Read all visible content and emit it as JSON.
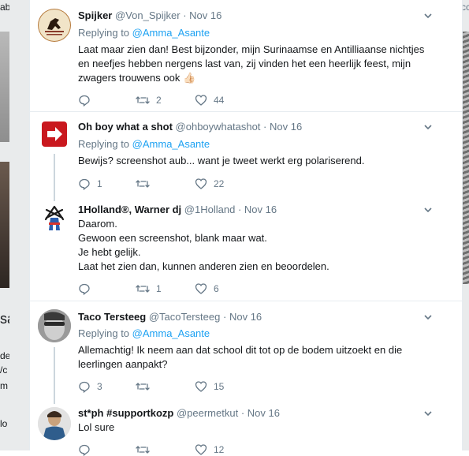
{
  "background": {
    "left_fragments": [
      "ab",
      "sa",
      "de",
      "/c",
      "m",
      "lo"
    ],
    "right_fragments": [
      "cc"
    ]
  },
  "tweets": [
    {
      "name": "Spijker",
      "handle": "@Von_Spijker",
      "time": "Nov 16",
      "replying_label": "Replying to",
      "replying_to": "@Amma_Asante",
      "lines": [
        "Laat maar zien dan! Best bijzonder, mijn Surinaamse en Antilliaanse nichtjes",
        "en neefjes hebben nergens last van, zij vinden het een heerlijk feest, mijn",
        "zwagers trouwens ook 👍🏻"
      ],
      "retweets": "2",
      "likes": "44",
      "replies": ""
    },
    {
      "name": "Oh boy what a shot",
      "handle": "@ohboywhatashot",
      "time": "Nov 16",
      "replying_label": "Replying to",
      "replying_to": "@Amma_Asante",
      "lines": [
        "Bewijs? screenshot aub... want je tweet werkt erg polariserend."
      ],
      "replies": "1",
      "retweets": "",
      "likes": "22"
    },
    {
      "name": "1Holland®, Warner dj",
      "handle": "@1Holland",
      "time": "Nov 16",
      "lines": [
        "Daarom.",
        "Gewoon een screenshot, blank maar wat.",
        "Je hebt gelijk.",
        "Laat het zien dan, kunnen anderen zien en beoordelen."
      ],
      "replies": "",
      "retweets": "1",
      "likes": "6"
    },
    {
      "name": "Taco Tersteeg",
      "handle": "@TacoTersteeg",
      "time": "Nov 16",
      "replying_label": "Replying to",
      "replying_to": "@Amma_Asante",
      "lines": [
        "Allemachtig! Ik neem aan dat school dit tot op de bodem uitzoekt en die",
        "leerlingen aanpakt?"
      ],
      "replies": "3",
      "retweets": "",
      "likes": "15"
    },
    {
      "name": "st*ph #supportkozp",
      "handle": "@peermetkut",
      "time": "Nov 16",
      "lines": [
        "Lol sure"
      ],
      "replies": "",
      "retweets": "",
      "likes": "12"
    }
  ],
  "dot": "·",
  "colors": {
    "link": "#1da1f2",
    "muted": "#657786",
    "text": "#14171a"
  }
}
